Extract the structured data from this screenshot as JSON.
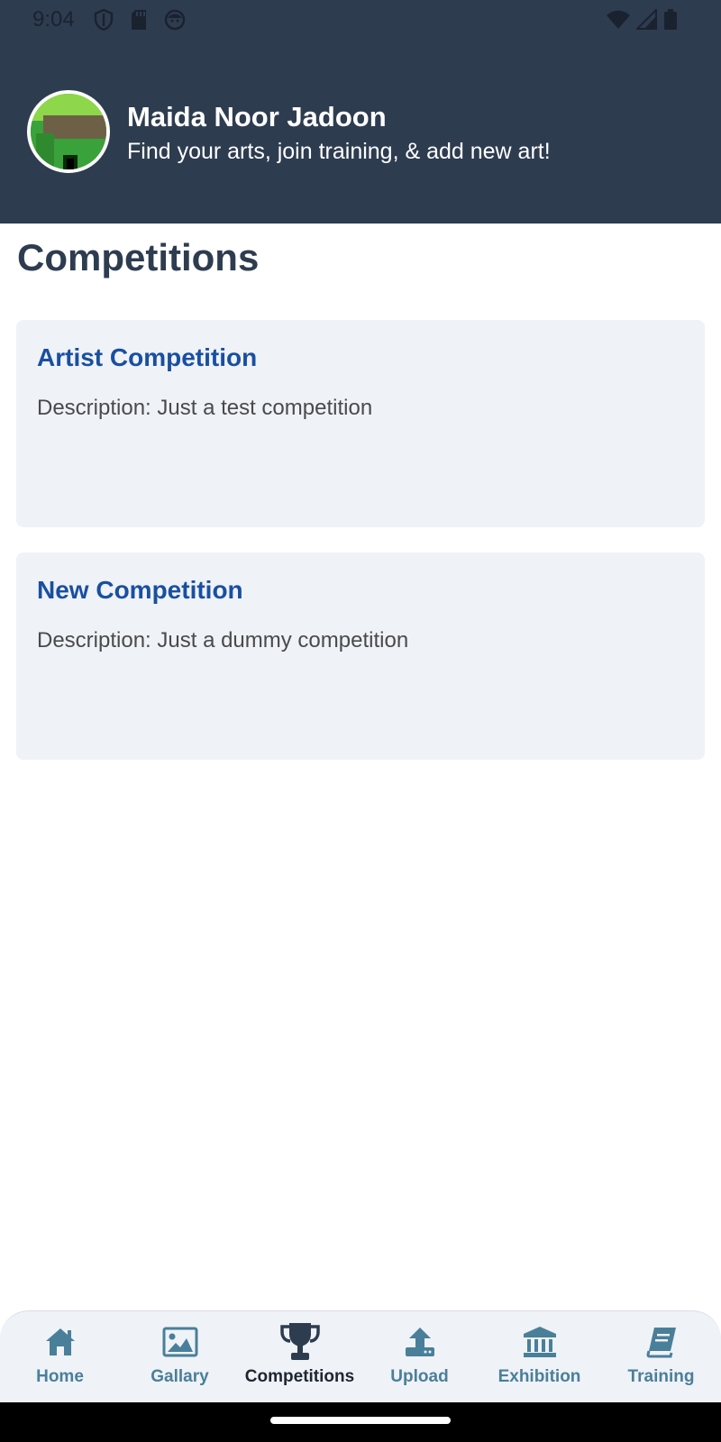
{
  "status_bar": {
    "time": "9:04",
    "left_icons": [
      "shield-icon",
      "sd-card-icon",
      "face-icon"
    ],
    "right_icons": [
      "wifi-icon",
      "signal-icon",
      "battery-icon"
    ]
  },
  "header": {
    "name": "Maida Noor Jadoon",
    "subtitle": "Find your arts, join training, & add new art!",
    "background_color": "#2e3c50"
  },
  "page": {
    "title": "Competitions"
  },
  "competitions": [
    {
      "title": "Artist Competition",
      "description": "Description: Just a test competition"
    },
    {
      "title": "New Competition",
      "description": "Description: Just a dummy competition"
    }
  ],
  "bottom_nav": {
    "items": [
      {
        "label": "Home",
        "icon": "home-icon",
        "active": false
      },
      {
        "label": "Gallary",
        "icon": "image-icon",
        "active": false
      },
      {
        "label": "Competitions",
        "icon": "trophy-icon",
        "active": true
      },
      {
        "label": "Upload",
        "icon": "upload-icon",
        "active": false
      },
      {
        "label": "Exhibition",
        "icon": "museum-icon",
        "active": false
      },
      {
        "label": "Training",
        "icon": "book-icon",
        "active": false
      }
    ],
    "accent_color": "#4a7f99",
    "active_color": "#1f2530"
  },
  "colors": {
    "card_title": "#1a4fa0",
    "card_background": "#eff2f7",
    "page_title": "#2e3c50"
  }
}
